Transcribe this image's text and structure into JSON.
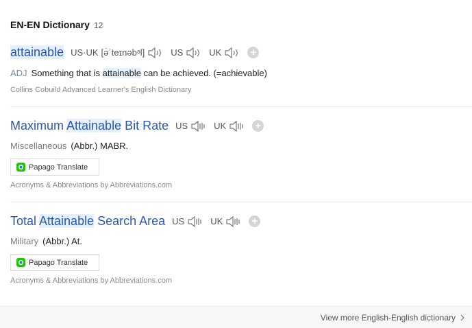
{
  "header": {
    "title": "EN-EN Dictionary",
    "count": "12"
  },
  "entries": [
    {
      "headword_pre": "",
      "headword_hl": "attainable",
      "headword_post": "",
      "pron_uk_label": "US·UK",
      "ipa": "[ə̇ˈteɪnəbᵊl]",
      "us_label": "US",
      "uk_label": "UK",
      "pos": "ADJ",
      "def_pre": "Something that is ",
      "def_hl": "attainable",
      "def_post": " can be achieved. (=achievable)",
      "source": "Collins Cobuild Advanced Learner's English Dictionary"
    },
    {
      "headword_pre": "Maximum ",
      "headword_hl": "Attainable",
      "headword_post": " Bit Rate",
      "us_label": "US",
      "uk_label": "UK",
      "pos": "Miscellaneous",
      "def": "(Abbr.) MABR.",
      "papago": "Papago Translate",
      "source": "Acronyms & Abbreviations by Abbreviations.com"
    },
    {
      "headword_pre": "Total ",
      "headword_hl": "Attainable",
      "headword_post": " Search Area",
      "us_label": "US",
      "uk_label": "UK",
      "pos": "Military",
      "def": "(Abbr.) At.",
      "papago": "Papago Translate",
      "source": "Acronyms & Abbreviations by Abbreviations.com"
    }
  ],
  "footer": {
    "more_label": "View more English-English dictionary"
  },
  "colors": {
    "link": "#2a56b0",
    "highlight": "#e4f0fb",
    "papago_green": "#1ec800"
  },
  "icons": [
    "speaker-icon",
    "add-wordbook-icon",
    "papago-icon",
    "chevron-right-icon"
  ]
}
